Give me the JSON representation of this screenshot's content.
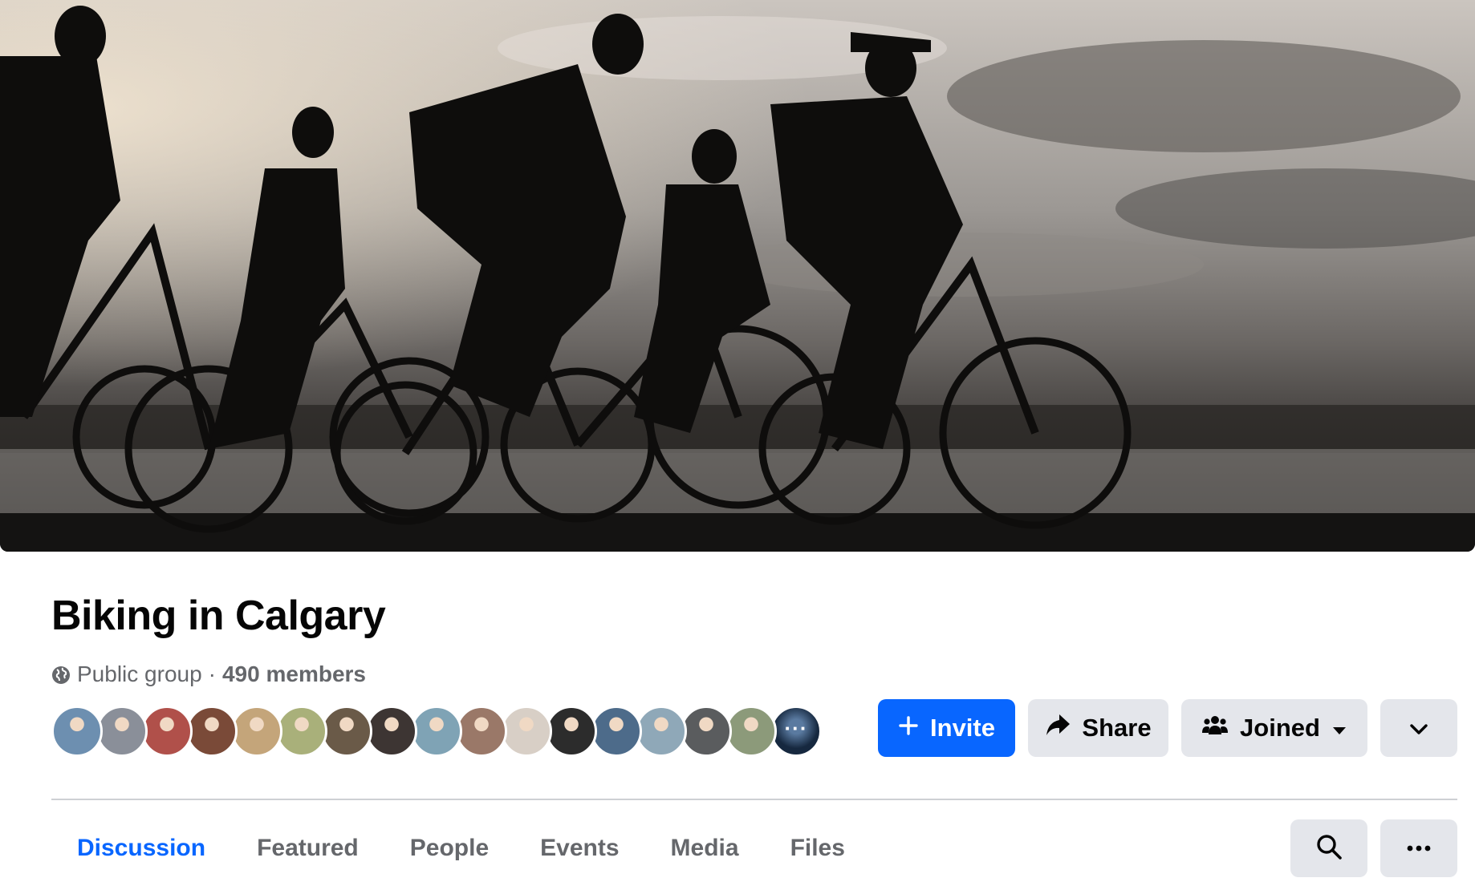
{
  "group": {
    "name": "Biking in Calgary",
    "privacy": "Public group",
    "separator": "·",
    "members": "490 members"
  },
  "member_avatars": [
    {
      "color": "#6d8fb0"
    },
    {
      "color": "#8a8f99"
    },
    {
      "color": "#b0504a"
    },
    {
      "color": "#7a4a38"
    },
    {
      "color": "#c4a57a"
    },
    {
      "color": "#a9b07a"
    },
    {
      "color": "#6a5a48"
    },
    {
      "color": "#3d3533"
    },
    {
      "color": "#7fa3b5"
    },
    {
      "color": "#9a7868"
    },
    {
      "color": "#d8cfc6"
    },
    {
      "color": "#2c2c2c"
    },
    {
      "color": "#4d6b8a"
    },
    {
      "color": "#8fa8b8"
    },
    {
      "color": "#5a5c5e"
    },
    {
      "color": "#8c9a7a"
    }
  ],
  "more_members_label": "···",
  "actions": {
    "invite_label": "Invite",
    "share_label": "Share",
    "joined_label": "Joined"
  },
  "tabs": [
    {
      "label": "Discussion",
      "active": true
    },
    {
      "label": "Featured",
      "active": false
    },
    {
      "label": "People",
      "active": false
    },
    {
      "label": "Events",
      "active": false
    },
    {
      "label": "Media",
      "active": false
    },
    {
      "label": "Files",
      "active": false
    }
  ],
  "colors": {
    "accent": "#0866ff",
    "button_gray": "#e4e6eb",
    "secondary_text": "#65676b"
  },
  "icons": {
    "privacy": "globe-icon",
    "invite": "plus-icon",
    "share": "share-arrow-icon",
    "joined": "group-people-icon",
    "joined_dropdown": "caret-down-icon",
    "header_more": "chevron-down-icon",
    "search": "search-icon",
    "tabs_more": "ellipsis-icon"
  }
}
